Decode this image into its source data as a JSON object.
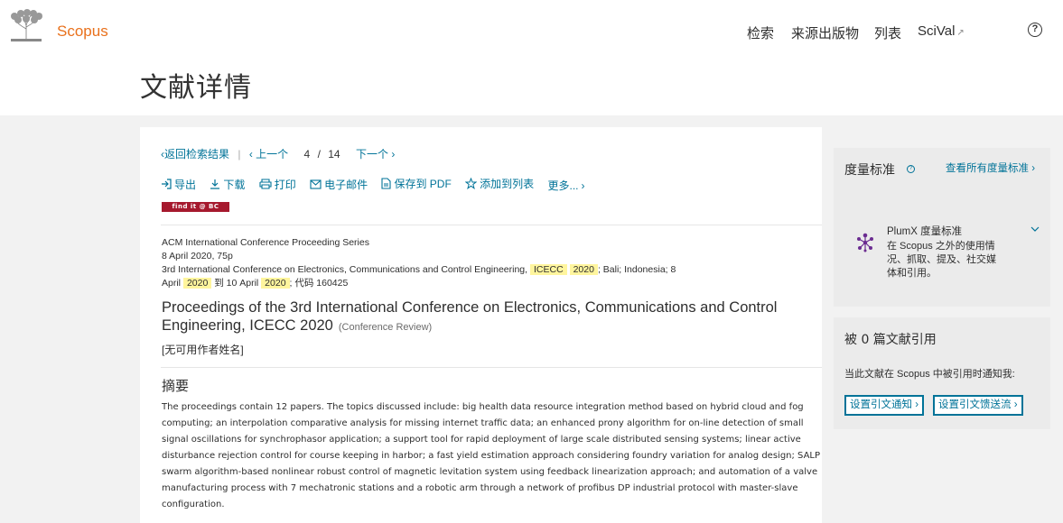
{
  "header": {
    "logo_text": "Scopus",
    "nav": [
      "检索",
      "来源出版物",
      "列表",
      "SciVal"
    ],
    "help": "?"
  },
  "page_title": "文献详情",
  "pager": {
    "back": "返回检索结果",
    "prev": "上一个",
    "current": "4",
    "slash": "/",
    "total": "14",
    "next": "下一个"
  },
  "toolbar": {
    "export": "导出",
    "download": "下载",
    "print": "打印",
    "email": "电子邮件",
    "save_pdf": "保存到 PDF",
    "add_list": "添加到列表",
    "more": "更多..."
  },
  "findit": "find it @ BC",
  "meta": {
    "series": "ACM International Conference Proceeding Series",
    "date_pages": "8 April 2020, 75p",
    "conf_name": "3rd International Conference on Electronics, Communications and Control Engineering,",
    "conf_abbr": "ICECC",
    "conf_year": "2020",
    "location_start": "; Bali; Indonesia; 8",
    "month1": "April",
    "year1": "2020",
    "to": "到 10 April",
    "year2": "2020",
    "code": "; 代码 160425"
  },
  "doc": {
    "title": "Proceedings of the 3rd International Conference on Electronics, Communications and Control Engineering, ICECC 2020",
    "type": "(Conference Review)",
    "authors": "[无可用作者姓名]"
  },
  "abstract": {
    "heading": "摘要",
    "text": "The proceedings contain 12 papers. The topics discussed include: big health data resource integration method based on hybrid cloud and fog computing; an interpolation comparative analysis for missing internet traffic data; an enhanced prony algorithm for on-line detection of small signal oscillations for synchrophasor application; a support tool for rapid deployment of large scale distributed sensing systems; linear active disturbance rejection control for course keeping in harbor; a fast yield estimation approach considering foundry variation for analog design; SALP swarm algorithm-based nonlinear robust control of magnetic levitation system using feedback linearization approach; and automation of a valve manufacturing process with 7 mechatronic stations and a robotic arm through a network of profibus DP industrial protocol with master-slave configuration."
  },
  "metrics": {
    "title": "度量标准",
    "view_all": "查看所有度量标准",
    "plumx_title": "PlumX 度量标准",
    "plumx_desc": "在 Scopus 之外的使用情况、抓取、提及、社交媒体和引用。"
  },
  "cited": {
    "title": "被 0 篇文献引用",
    "desc": "当此文献在 Scopus 中被引用时通知我:",
    "btn_alert": "设置引文通知",
    "btn_feed": "设置引文馈送流"
  },
  "colors": {
    "link": "#007398",
    "brand": "#e9711c",
    "highlight": "#fff59d",
    "findit": "#a6192e"
  }
}
